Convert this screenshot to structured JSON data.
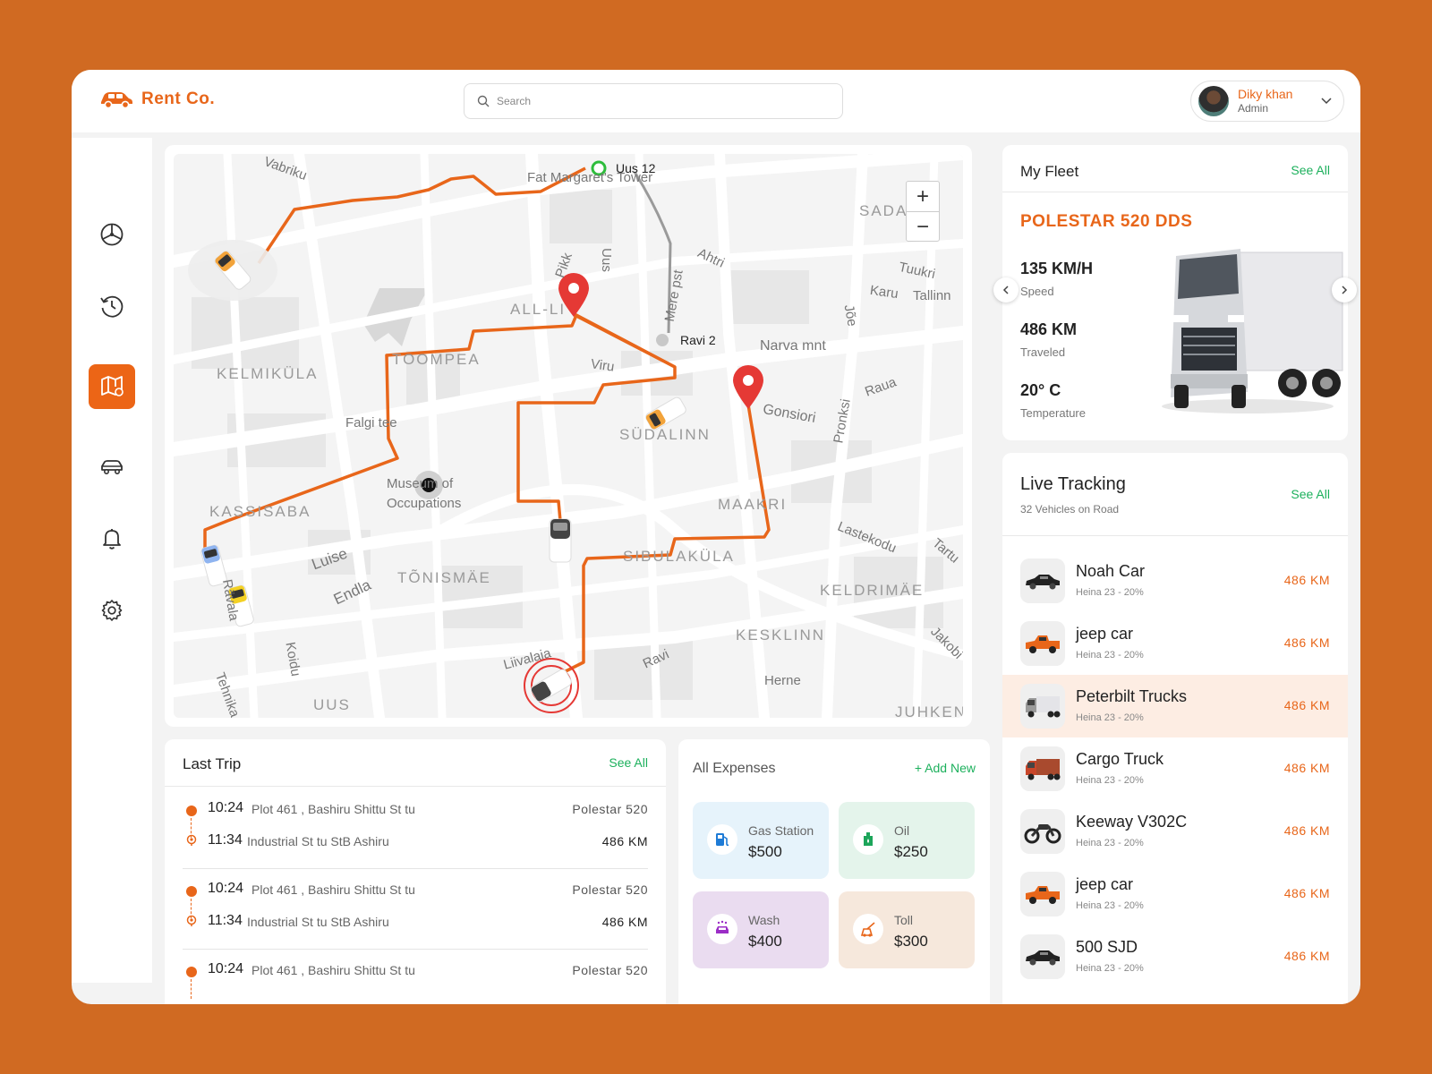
{
  "brand": {
    "name": "Rent Co."
  },
  "search": {
    "placeholder": "Search"
  },
  "user": {
    "name": "Diky khan",
    "role": "Admin"
  },
  "sidebar": {
    "items": [
      {
        "icon": "steering-wheel-icon",
        "active": false
      },
      {
        "icon": "history-icon",
        "active": false
      },
      {
        "icon": "map-icon",
        "active": true
      },
      {
        "icon": "car-icon",
        "active": false
      },
      {
        "icon": "bell-icon",
        "active": false
      },
      {
        "icon": "settings-icon",
        "active": false
      }
    ]
  },
  "map": {
    "origin_label": "Uus 12",
    "stop_label": "Ravi 2",
    "zoom_in": "+",
    "zoom_out": "−",
    "areas": [
      "KELMIKÜLA",
      "TOOMPEA",
      "ALL-LI",
      "SÜDALINN",
      "KASSISABA",
      "TÕNISMÄE",
      "SIBULAKÜLA",
      "MAAKRI",
      "KELDRIMÄE",
      "KESKLINN",
      "UUS",
      "SADA",
      "JUHKEN"
    ],
    "streets": [
      "Vabriku",
      "Fat Margaret's Tower",
      "Pikk",
      "Uus",
      "Mere pst",
      "Ahtri",
      "Tuukri",
      "Karu",
      "Tallinn",
      "Narva mnt",
      "Jõe",
      "Viru",
      "Raua",
      "Gonsiori",
      "Falgi tee",
      "Museum of",
      "Occupations",
      "Pronksi",
      "Luise",
      "Endla",
      "Lastekodu",
      "Tartu",
      "Liivalaia",
      "Ravi",
      "Herne",
      "Jakobi",
      "Koidu",
      "Tehnika",
      "Rävala"
    ]
  },
  "fleet": {
    "title": "My Fleet",
    "see_all": "See All",
    "vehicle_name": "POLESTAR 520 DDS",
    "speed_value": "135 KM/H",
    "speed_label": "Speed",
    "traveled_value": "486 KM",
    "traveled_label": "Traveled",
    "temp_value": "20° C",
    "temp_label": "Temperature"
  },
  "live": {
    "title": "Live Tracking",
    "subtitle": "32 Vehicles on Road",
    "see_all": "See All",
    "vehicles": [
      {
        "name": "Noah Car",
        "sub": "Heina 23 - 20%",
        "dist": "486 KM",
        "icon": "sedan-icon",
        "color": "#222222"
      },
      {
        "name": "jeep car",
        "sub": "Heina 23 - 20%",
        "dist": "486 KM",
        "icon": "pickup-icon",
        "color": "#E8661A"
      },
      {
        "name": "Peterbilt Trucks",
        "sub": "Heina 23 - 20%",
        "dist": "486 KM",
        "icon": "truck-icon",
        "color": "#9A9A9A"
      },
      {
        "name": "Cargo Truck",
        "sub": "Heina 23 - 20%",
        "dist": "486 KM",
        "icon": "cargo-truck-icon",
        "color": "#C8462A"
      },
      {
        "name": "Keeway V302C",
        "sub": "Heina 23 - 20%",
        "dist": "486 KM",
        "icon": "motorcycle-icon",
        "color": "#333333"
      },
      {
        "name": "jeep car",
        "sub": "Heina 23 - 20%",
        "dist": "486 KM",
        "icon": "pickup-icon",
        "color": "#E8661A"
      },
      {
        "name": "500 SJD",
        "sub": "Heina 23 - 20%",
        "dist": "486 KM",
        "icon": "sedan-icon",
        "color": "#222222"
      }
    ]
  },
  "trips": {
    "title": "Last Trip",
    "see_all": "See All",
    "items": [
      {
        "start_time": "10:24",
        "start_addr": "Plot 461 , Bashiru Shittu St tu",
        "vehicle": "Polestar 520",
        "end_time": "11:34",
        "end_addr": "Industrial St tu StB Ashiru",
        "distance": "486 KM"
      },
      {
        "start_time": "10:24",
        "start_addr": "Plot 461 , Bashiru Shittu St tu",
        "vehicle": "Polestar 520",
        "end_time": "11:34",
        "end_addr": "Industrial St tu StB Ashiru",
        "distance": "486 KM"
      },
      {
        "start_time": "10:24",
        "start_addr": "Plot 461 , Bashiru Shittu St tu",
        "vehicle": "Polestar 520",
        "end_time": "",
        "end_addr": "",
        "distance": ""
      }
    ]
  },
  "expenses": {
    "title": "All Expenses",
    "add_new": "+ Add New",
    "tiles": [
      {
        "label": "Gas Station",
        "value": "$500",
        "icon": "fuel-icon",
        "bg": "#E6F3FB",
        "accent": "#1E7BD6"
      },
      {
        "label": "Oil",
        "value": "$250",
        "icon": "oil-can-icon",
        "bg": "#E4F4EB",
        "accent": "#1CA55A"
      },
      {
        "label": "Wash",
        "value": "$400",
        "icon": "car-wash-icon",
        "bg": "#EADCF0",
        "accent": "#9B2DC6"
      },
      {
        "label": "Toll",
        "value": "$300",
        "icon": "toll-icon",
        "bg": "#F6E8DC",
        "accent": "#E8661A"
      }
    ]
  },
  "colors": {
    "brand": "#E8661A",
    "background": "#D06A22",
    "accent_green": "#1CB05C"
  }
}
